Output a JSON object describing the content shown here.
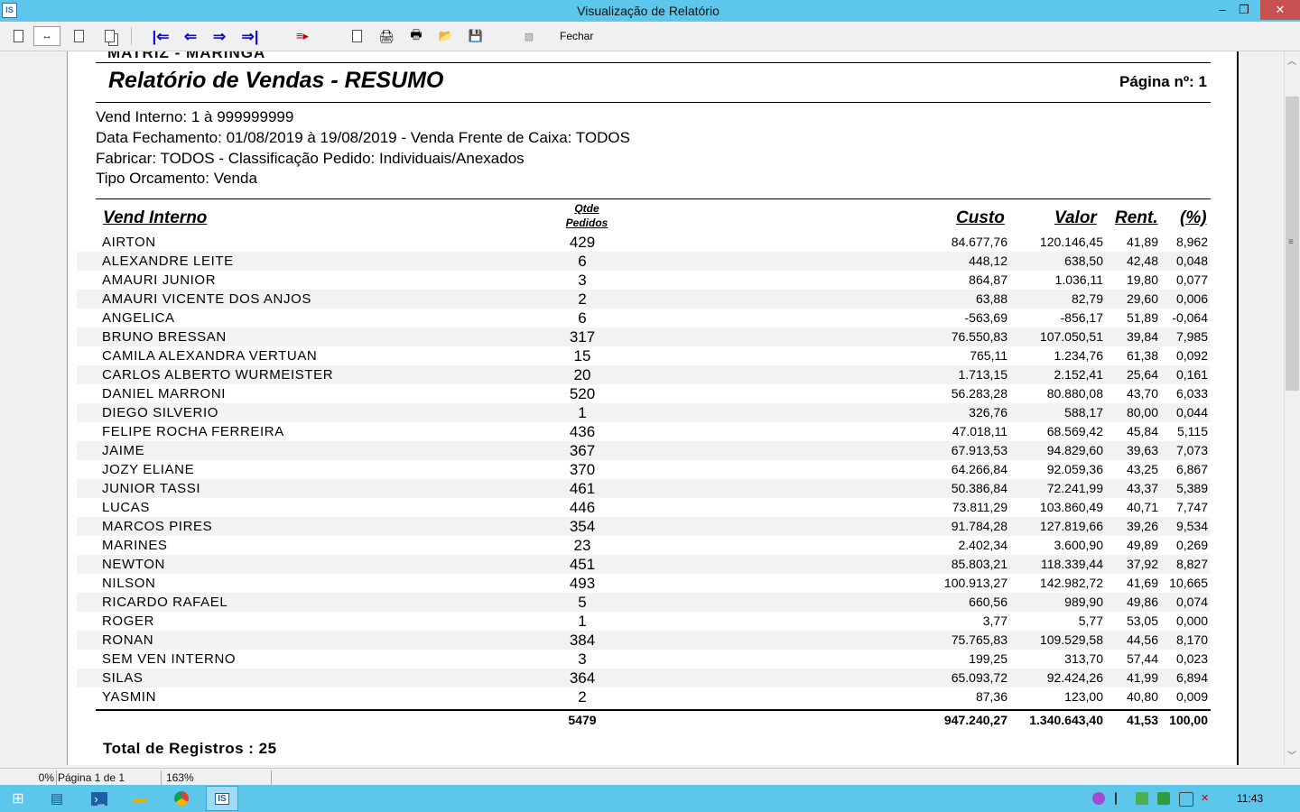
{
  "window": {
    "title": "Visualização de Relatório",
    "app_icon_text": "IS",
    "minimize": "‒",
    "maximize": "❐",
    "close": "✕"
  },
  "toolbar": {
    "close_label": "Fechar"
  },
  "report": {
    "cut_top_text": "MATRIZ - MARINGÁ",
    "title": "Relatório de Vendas - RESUMO",
    "page_label": "Página nº: 1",
    "filters": [
      "Vend Interno: 1 à 999999999",
      "Data Fechamento: 01/08/2019 à 19/08/2019 - Venda Frente de Caixa: TODOS",
      "Fabricar: TODOS - Classificação Pedido: Individuais/Anexados",
      "Tipo Orcamento: Venda"
    ],
    "columns": {
      "name": "Vend Interno",
      "qtde_1": "Qtde",
      "qtde_2": "Pedidos",
      "custo": "Custo",
      "valor": "Valor",
      "rent": "Rent.",
      "pct": "(%)"
    },
    "rows": [
      [
        "AIRTON",
        "429",
        "84.677,76",
        "120.146,45",
        "41,89",
        "8,962"
      ],
      [
        "ALEXANDRE LEITE",
        "6",
        "448,12",
        "638,50",
        "42,48",
        "0,048"
      ],
      [
        "AMAURI JUNIOR",
        "3",
        "864,87",
        "1.036,11",
        "19,80",
        "0,077"
      ],
      [
        "AMAURI VICENTE DOS ANJOS",
        "2",
        "63,88",
        "82,79",
        "29,60",
        "0,006"
      ],
      [
        "ANGELICA",
        "6",
        "-563,69",
        "-856,17",
        "51,89",
        "-0,064"
      ],
      [
        "BRUNO BRESSAN",
        "317",
        "76.550,83",
        "107.050,51",
        "39,84",
        "7,985"
      ],
      [
        "CAMILA ALEXANDRA VERTUAN",
        "15",
        "765,11",
        "1.234,76",
        "61,38",
        "0,092"
      ],
      [
        "CARLOS ALBERTO WURMEISTER",
        "20",
        "1.713,15",
        "2.152,41",
        "25,64",
        "0,161"
      ],
      [
        "DANIEL MARRONI",
        "520",
        "56.283,28",
        "80.880,08",
        "43,70",
        "6,033"
      ],
      [
        "DIEGO SILVERIO",
        "1",
        "326,76",
        "588,17",
        "80,00",
        "0,044"
      ],
      [
        "FELIPE ROCHA FERREIRA",
        "436",
        "47.018,11",
        "68.569,42",
        "45,84",
        "5,115"
      ],
      [
        "JAIME",
        "367",
        "67.913,53",
        "94.829,60",
        "39,63",
        "7,073"
      ],
      [
        "JOZY ELIANE",
        "370",
        "64.266,84",
        "92.059,36",
        "43,25",
        "6,867"
      ],
      [
        "JUNIOR TASSI",
        "461",
        "50.386,84",
        "72.241,99",
        "43,37",
        "5,389"
      ],
      [
        "LUCAS",
        "446",
        "73.811,29",
        "103.860,49",
        "40,71",
        "7,747"
      ],
      [
        "MARCOS PIRES",
        "354",
        "91.784,28",
        "127.819,66",
        "39,26",
        "9,534"
      ],
      [
        "MARINES",
        "23",
        "2.402,34",
        "3.600,90",
        "49,89",
        "0,269"
      ],
      [
        "NEWTON",
        "451",
        "85.803,21",
        "118.339,44",
        "37,92",
        "8,827"
      ],
      [
        "NILSON",
        "493",
        "100.913,27",
        "142.982,72",
        "41,69",
        "10,665"
      ],
      [
        "RICARDO RAFAEL",
        "5",
        "660,56",
        "989,90",
        "49,86",
        "0,074"
      ],
      [
        "ROGER",
        "1",
        "3,77",
        "5,77",
        "53,05",
        "0,000"
      ],
      [
        "RONAN",
        "384",
        "75.765,83",
        "109.529,58",
        "44,56",
        "8,170"
      ],
      [
        "SEM VEN INTERNO",
        "3",
        "199,25",
        "313,70",
        "57,44",
        "0,023"
      ],
      [
        "SILAS",
        "364",
        "65.093,72",
        "92.424,26",
        "41,99",
        "6,894"
      ],
      [
        "YASMIN",
        "2",
        "87,36",
        "123,00",
        "40,80",
        "0,009"
      ]
    ],
    "totals": {
      "qtde": "5479",
      "custo": "947.240,27",
      "valor": "1.340.643,40",
      "rent": "41,53",
      "pct": "100,00"
    },
    "total_records": "Total de Registros : 25"
  },
  "status": {
    "progress": "0%",
    "page": "Página 1 de 1",
    "zoom": "163%"
  },
  "taskbar": {
    "clock": "11:43"
  }
}
